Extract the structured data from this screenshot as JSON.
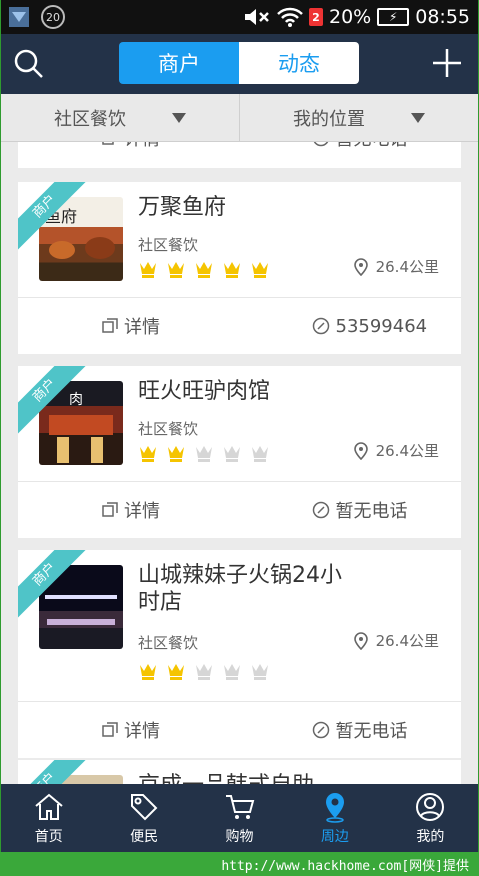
{
  "status_bar": {
    "notification_count": "20",
    "battery": "20%",
    "time": "08:55"
  },
  "header": {
    "tabs": [
      "商户",
      "动态"
    ],
    "active_tab": "商户"
  },
  "filters": [
    {
      "label": "社区餐饮"
    },
    {
      "label": "我的位置"
    }
  ],
  "partial_top": {
    "detail": "详情",
    "phone": "暂无电话"
  },
  "stores": [
    {
      "ribbon": "商户",
      "name": "万聚鱼府",
      "category": "社区餐饮",
      "rating": 5,
      "distance": "26.4公里",
      "detail": "详情",
      "phone": "53599464"
    },
    {
      "ribbon": "商户",
      "name": "旺火旺驴肉馆",
      "category": "社区餐饮",
      "rating": 2,
      "distance": "26.4公里",
      "detail": "详情",
      "phone": "暂无电话"
    },
    {
      "ribbon": "商户",
      "name": "山城辣妹子火锅24小时店",
      "category": "社区餐饮",
      "rating": 2,
      "distance": "26.4公里",
      "detail": "详情",
      "phone": "暂无电话"
    },
    {
      "ribbon": "商户",
      "name": "京成一品韩式自助"
    }
  ],
  "tabbar": [
    {
      "label": "首页",
      "icon": "home-icon"
    },
    {
      "label": "便民",
      "icon": "tag-icon"
    },
    {
      "label": "购物",
      "icon": "cart-icon"
    },
    {
      "label": "周边",
      "icon": "location-pin-icon"
    },
    {
      "label": "我的",
      "icon": "user-icon"
    }
  ],
  "watermark": "http://www.hackhome.com[网侠]提供",
  "colors": {
    "accent": "#1b9df0",
    "navbar": "#233248",
    "ribbon": "#4fc4c8",
    "star": "#f5c400"
  }
}
